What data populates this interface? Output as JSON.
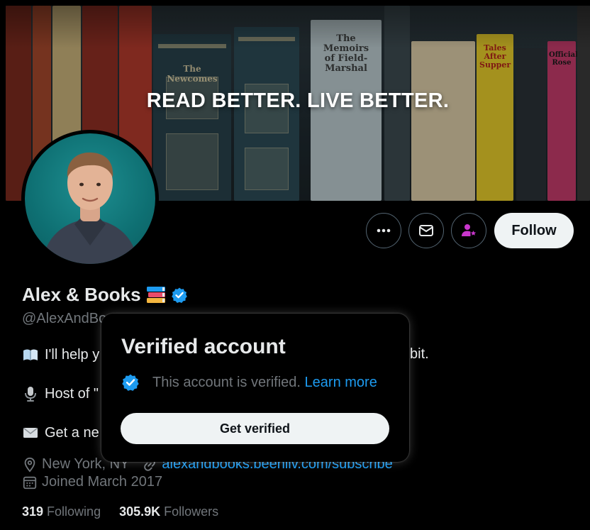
{
  "banner": {
    "headline": "READ BETTER. LIVE BETTER."
  },
  "book_spines": [
    "The Newcomes",
    "The Memoirs of Field-Marshal",
    "Tales After Supper",
    "Official Rose"
  ],
  "actions": {
    "more_icon": "more-horizontal-icon",
    "message_icon": "envelope-icon",
    "subscribe_icon": "person-star-icon",
    "follow_label": "Follow"
  },
  "profile": {
    "display_name": "Alex & Books",
    "handle": "@AlexAndBo",
    "verified_color": "#1d9bf0"
  },
  "bio": {
    "line1_fragment": "I'll help y",
    "line1_tail": "bit.",
    "line2_fragment": "Host of \"",
    "line3_fragment": "Get a ne"
  },
  "meta": {
    "location": "New York, NY",
    "website": "alexandbooks.beehiiv.com/subscribe",
    "joined": "Joined March 2017"
  },
  "stats": {
    "following_count": "319",
    "following_label": "Following",
    "followers_count": "305.9K",
    "followers_label": "Followers"
  },
  "hovercard": {
    "title": "Verified account",
    "text": "This account is verified.",
    "learn_more": "Learn more",
    "button_label": "Get verified"
  },
  "colors": {
    "accent_blue": "#1d9bf0",
    "subscribe_purple": "#c936cc",
    "muted": "#71767b"
  }
}
